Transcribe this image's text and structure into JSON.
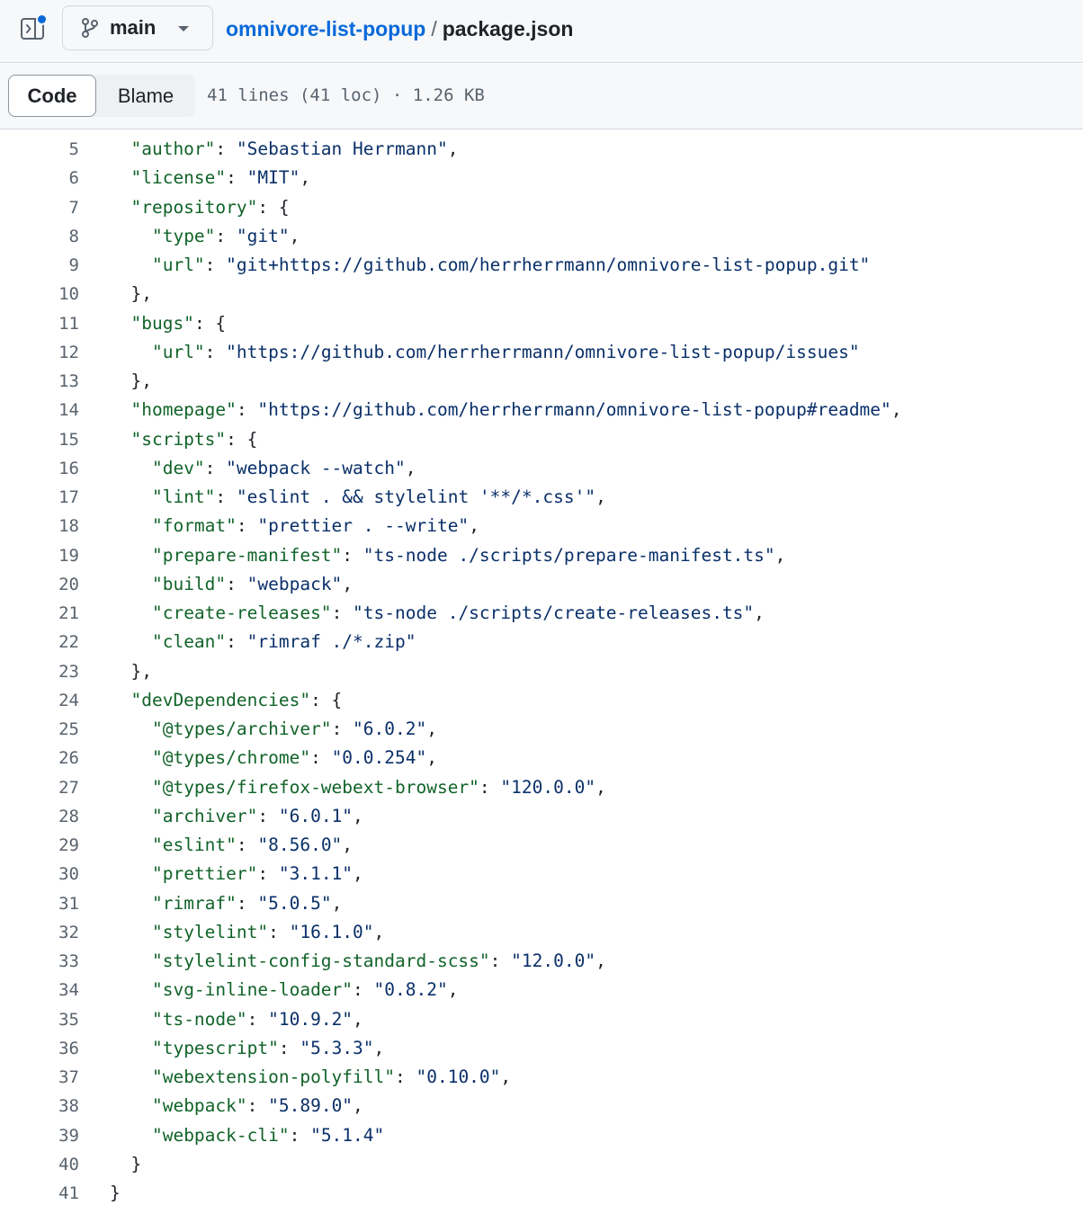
{
  "header": {
    "branch": "main",
    "repo": "omnivore-list-popup",
    "separator": "/",
    "file": "package.json"
  },
  "toolbar": {
    "code_label": "Code",
    "blame_label": "Blame",
    "meta": "41 lines (41 loc) · 1.26 KB"
  },
  "colors": {
    "link": "#0969da",
    "json_key": "#116329",
    "json_string": "#0a3069",
    "line_number": "#59636e"
  },
  "code_lines": [
    {
      "n": "5",
      "indent": 2,
      "key": "author",
      "value": "Sebastian Herrmann",
      "suffix": ","
    },
    {
      "n": "6",
      "indent": 2,
      "key": "license",
      "value": "MIT",
      "suffix": ","
    },
    {
      "n": "7",
      "indent": 2,
      "key": "repository",
      "suffix": ": {"
    },
    {
      "n": "8",
      "indent": 4,
      "key": "type",
      "value": "git",
      "suffix": ","
    },
    {
      "n": "9",
      "indent": 4,
      "key": "url",
      "value": "git+https://github.com/herrherrmann/omnivore-list-popup.git",
      "suffix": ""
    },
    {
      "n": "10",
      "indent": 2,
      "raw": "},"
    },
    {
      "n": "11",
      "indent": 2,
      "key": "bugs",
      "suffix": ": {"
    },
    {
      "n": "12",
      "indent": 4,
      "key": "url",
      "value": "https://github.com/herrherrmann/omnivore-list-popup/issues",
      "suffix": ""
    },
    {
      "n": "13",
      "indent": 2,
      "raw": "},"
    },
    {
      "n": "14",
      "indent": 2,
      "key": "homepage",
      "value": "https://github.com/herrherrmann/omnivore-list-popup#readme",
      "suffix": ","
    },
    {
      "n": "15",
      "indent": 2,
      "key": "scripts",
      "suffix": ": {"
    },
    {
      "n": "16",
      "indent": 4,
      "key": "dev",
      "value": "webpack --watch",
      "suffix": ","
    },
    {
      "n": "17",
      "indent": 4,
      "key": "lint",
      "value": "eslint . && stylelint '**/*.css'",
      "suffix": ","
    },
    {
      "n": "18",
      "indent": 4,
      "key": "format",
      "value": "prettier . --write",
      "suffix": ","
    },
    {
      "n": "19",
      "indent": 4,
      "key": "prepare-manifest",
      "value": "ts-node ./scripts/prepare-manifest.ts",
      "suffix": ","
    },
    {
      "n": "20",
      "indent": 4,
      "key": "build",
      "value": "webpack",
      "suffix": ","
    },
    {
      "n": "21",
      "indent": 4,
      "key": "create-releases",
      "value": "ts-node ./scripts/create-releases.ts",
      "suffix": ","
    },
    {
      "n": "22",
      "indent": 4,
      "key": "clean",
      "value": "rimraf ./*.zip",
      "suffix": ""
    },
    {
      "n": "23",
      "indent": 2,
      "raw": "},"
    },
    {
      "n": "24",
      "indent": 2,
      "key": "devDependencies",
      "suffix": ": {"
    },
    {
      "n": "25",
      "indent": 4,
      "key": "@types/archiver",
      "value": "6.0.2",
      "suffix": ","
    },
    {
      "n": "26",
      "indent": 4,
      "key": "@types/chrome",
      "value": "0.0.254",
      "suffix": ","
    },
    {
      "n": "27",
      "indent": 4,
      "key": "@types/firefox-webext-browser",
      "value": "120.0.0",
      "suffix": ","
    },
    {
      "n": "28",
      "indent": 4,
      "key": "archiver",
      "value": "6.0.1",
      "suffix": ","
    },
    {
      "n": "29",
      "indent": 4,
      "key": "eslint",
      "value": "8.56.0",
      "suffix": ","
    },
    {
      "n": "30",
      "indent": 4,
      "key": "prettier",
      "value": "3.1.1",
      "suffix": ","
    },
    {
      "n": "31",
      "indent": 4,
      "key": "rimraf",
      "value": "5.0.5",
      "suffix": ","
    },
    {
      "n": "32",
      "indent": 4,
      "key": "stylelint",
      "value": "16.1.0",
      "suffix": ","
    },
    {
      "n": "33",
      "indent": 4,
      "key": "stylelint-config-standard-scss",
      "value": "12.0.0",
      "suffix": ","
    },
    {
      "n": "34",
      "indent": 4,
      "key": "svg-inline-loader",
      "value": "0.8.2",
      "suffix": ","
    },
    {
      "n": "35",
      "indent": 4,
      "key": "ts-node",
      "value": "10.9.2",
      "suffix": ","
    },
    {
      "n": "36",
      "indent": 4,
      "key": "typescript",
      "value": "5.3.3",
      "suffix": ","
    },
    {
      "n": "37",
      "indent": 4,
      "key": "webextension-polyfill",
      "value": "0.10.0",
      "suffix": ","
    },
    {
      "n": "38",
      "indent": 4,
      "key": "webpack",
      "value": "5.89.0",
      "suffix": ","
    },
    {
      "n": "39",
      "indent": 4,
      "key": "webpack-cli",
      "value": "5.1.4",
      "suffix": ""
    },
    {
      "n": "40",
      "indent": 2,
      "raw": "}"
    },
    {
      "n": "41",
      "indent": 0,
      "raw": "}"
    }
  ]
}
